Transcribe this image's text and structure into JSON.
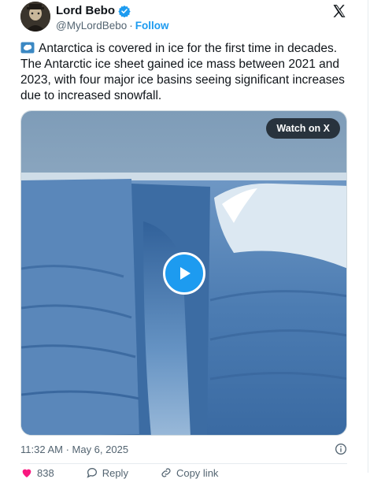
{
  "author": {
    "name": "Lord Bebo",
    "handle": "@MyLordBebo",
    "separator": "·",
    "follow_label": "Follow"
  },
  "tweet": {
    "text": "Antarctica is covered in ice for the first time in decades. The Antarctic ice sheet gained ice mass between 2021 and 2023, with four major ice basins seeing significant increases due to increased snowfall.",
    "emoji_icon": "snowflake-emoji-icon"
  },
  "media": {
    "watch_label": "Watch on X"
  },
  "meta": {
    "timestamp": "11:32 AM · May 6, 2025"
  },
  "actions": {
    "likes": "838",
    "reply_label": "Reply",
    "share_label": "Copy link"
  },
  "colors": {
    "accent": "#1d9bf0",
    "text": "#0f1419",
    "muted": "#536471",
    "ice": "#4f7fb4"
  }
}
